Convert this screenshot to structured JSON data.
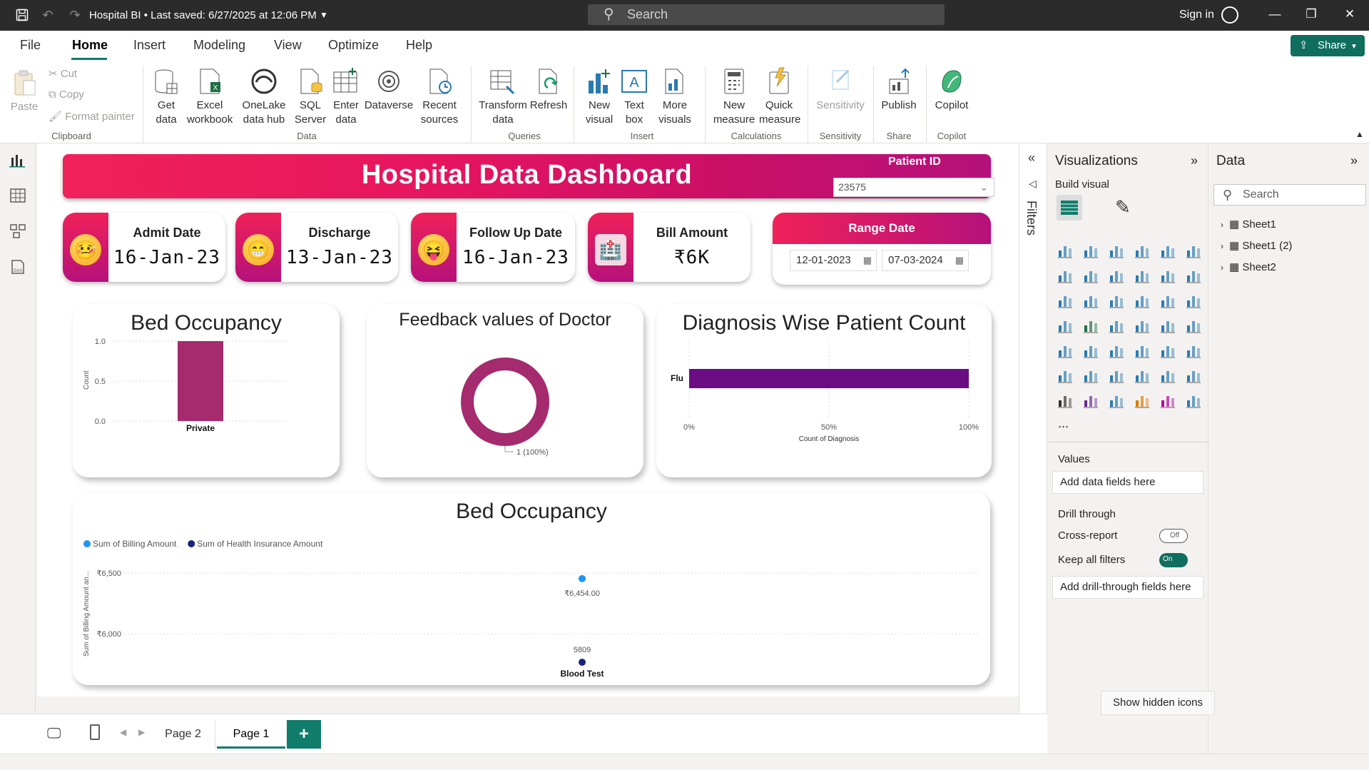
{
  "titlebar": {
    "title": "Hospital BI • Last saved: 6/27/2025 at 12:06 PM",
    "search_placeholder": "Search",
    "signin": "Sign in"
  },
  "menu": {
    "tabs": [
      "File",
      "Home",
      "Insert",
      "Modeling",
      "View",
      "Optimize",
      "Help"
    ],
    "share": "Share"
  },
  "ribbon": {
    "clipboard": {
      "paste": "Paste",
      "cut": "Cut",
      "copy": "Copy",
      "format_painter": "Format painter",
      "label": "Clipboard"
    },
    "data": {
      "get_data": "Get data",
      "excel": "Excel workbook",
      "onelake": "OneLake data hub",
      "sql": "SQL Server",
      "enter": "Enter data",
      "dataverse": "Dataverse",
      "recent": "Recent sources",
      "label": "Data"
    },
    "queries": {
      "transform": "Transform data",
      "refresh": "Refresh",
      "label": "Queries"
    },
    "insert": {
      "new_visual": "New visual",
      "text_box": "Text box",
      "more_visuals": "More visuals",
      "label": "Insert"
    },
    "calculations": {
      "new_measure": "New measure",
      "quick_measure": "Quick measure",
      "label": "Calculations"
    },
    "sensitivity": {
      "btn": "Sensitivity",
      "label": "Sensitivity"
    },
    "share": {
      "publish": "Publish",
      "label": "Share"
    },
    "copilot": {
      "btn": "Copilot",
      "label": "Copilot"
    }
  },
  "dashboard": {
    "title": "Hospital Data Dashboard",
    "patient_id_label": "Patient ID",
    "patient_id_value": "23575",
    "kpis": [
      {
        "title": "Admit Date",
        "value": "16-Jan-23",
        "emoji": "🤒"
      },
      {
        "title": "Discharge",
        "value": "13-Jan-23",
        "emoji": "😁"
      },
      {
        "title": "Follow Up Date",
        "value": "16-Jan-23",
        "emoji": "😝"
      },
      {
        "title": "Bill Amount",
        "value": "₹6K",
        "emoji": "🏥"
      }
    ],
    "range": {
      "title": "Range Date",
      "start": "12-01-2023",
      "end": "07-03-2024"
    }
  },
  "chart_data": [
    {
      "type": "bar",
      "title": "Bed Occupancy",
      "categories": [
        "Private"
      ],
      "values": [
        1
      ],
      "ylabel": "Count",
      "ylim": [
        0,
        1
      ],
      "yticks": [
        "1.0",
        "0.5",
        "0.0"
      ],
      "color": "#a52a6e"
    },
    {
      "type": "pie",
      "title": "Feedback values of Doctor",
      "slices": [
        {
          "label": "1 (100%)",
          "value": 1
        }
      ],
      "color": "#a52a6e"
    },
    {
      "type": "bar",
      "orientation": "horizontal",
      "title": "Diagnosis Wise Patient Count",
      "categories": [
        "Flu"
      ],
      "values": [
        1
      ],
      "xlabel": "Count of Diagnosis",
      "xticks": [
        "0%",
        "50%",
        "100%"
      ],
      "color": "#6a0d83"
    },
    {
      "type": "scatter",
      "title": "Bed Occupancy",
      "categories": [
        "Blood Test"
      ],
      "series": [
        {
          "name": "Sum of Billing Amount",
          "values": [
            6454
          ],
          "label": "₹6,454.00",
          "color": "#2196f3"
        },
        {
          "name": "Sum of Health Insurance Amount",
          "values": [
            5809
          ],
          "label": "5809",
          "color": "#1a237e"
        }
      ],
      "ylabel": "Sum of Billing Amount an...",
      "yticks": [
        "₹6,500",
        "₹6,000"
      ]
    }
  ],
  "viz_pane": {
    "title": "Visualizations",
    "build_visual": "Build visual",
    "more": "...",
    "values_label": "Values",
    "values_well": "Add data fields here",
    "drill_through": "Drill through",
    "cross_report": "Cross-report",
    "cross_report_state": "Off",
    "keep_filters": "Keep all filters",
    "keep_filters_state": "On",
    "drill_well": "Add drill-through fields here"
  },
  "data_pane": {
    "title": "Data",
    "search_placeholder": "Search",
    "tables": [
      "Sheet1",
      "Sheet1 (2)",
      "Sheet2"
    ]
  },
  "filters": {
    "label": "Filters"
  },
  "pages": {
    "tabs": [
      "Page 2",
      "Page 1"
    ],
    "add": "+"
  },
  "tooltip": {
    "hidden_icons": "Show hidden icons"
  }
}
